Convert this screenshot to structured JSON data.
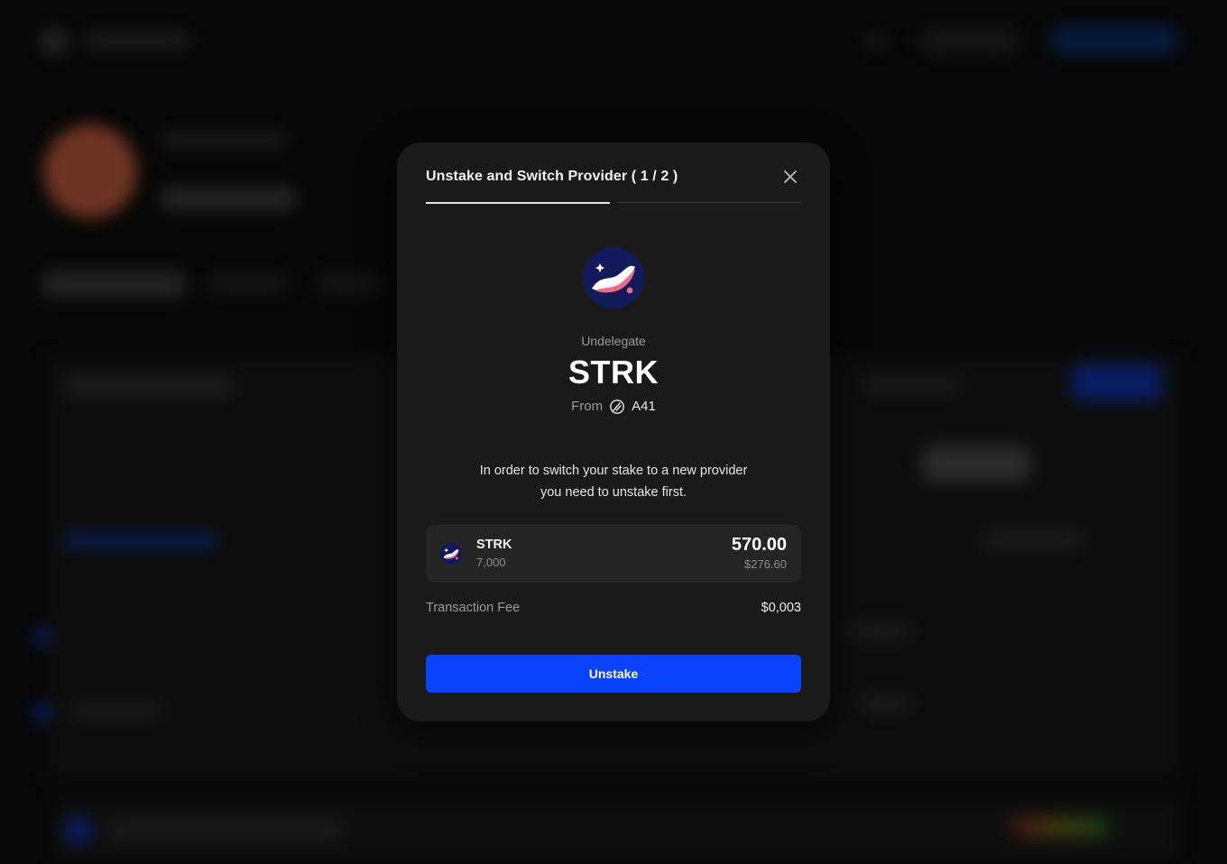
{
  "modal": {
    "title": "Unstake and Switch Provider ( 1 / 2 )",
    "close_icon": "close-icon",
    "steps_total": 2,
    "step_current": 1,
    "action_label": "Undelegate",
    "token_name": "STRK",
    "from_label": "From",
    "provider_name": "A41",
    "description_line1": "In order to switch your stake to a new provider",
    "description_line2": "you need to unstake first.",
    "card": {
      "symbol": "STRK",
      "sub_amount": "7,000",
      "amount": "570.00",
      "usd_value": "$276.60"
    },
    "fee_label": "Transaction Fee",
    "fee_value": "$0,003",
    "primary_button": "Unstake"
  },
  "colors": {
    "accent": "#0a43ff",
    "modal_bg": "#1a1a1a",
    "card_bg": "#252525",
    "token_logo_bg": "#121a5c",
    "token_logo_accent": "#ef6a82"
  }
}
